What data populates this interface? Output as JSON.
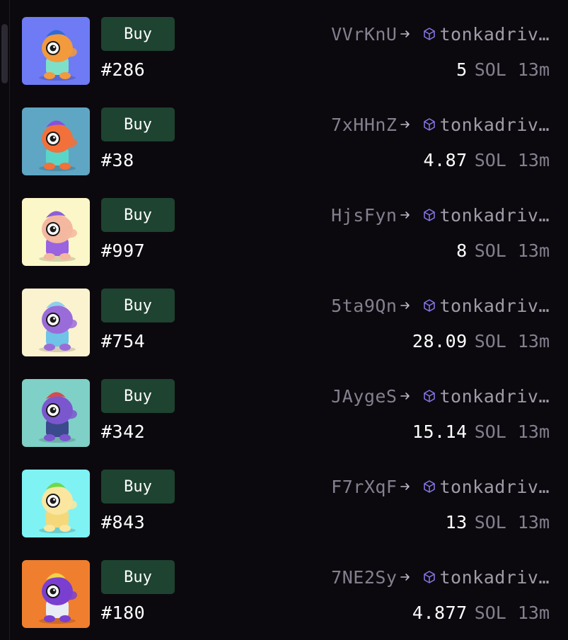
{
  "sales": [
    {
      "buy_label": "Buy",
      "token": "#286",
      "from": "VVrKnU",
      "to": "tonkadriv…",
      "price": "5",
      "unit": "SOL",
      "time": "13m",
      "bg": "#6e7bf5",
      "body": "#f29a3c",
      "accent": "#2f6bd6",
      "shirt": "#7fe0c9"
    },
    {
      "buy_label": "Buy",
      "token": "#38",
      "from": "7xHHnZ",
      "to": "tonkadriv…",
      "price": "4.87",
      "unit": "SOL",
      "time": "13m",
      "bg": "#5fa6c4",
      "body": "#f2703a",
      "accent": "#8a4fe0",
      "shirt": "#5ad6c8"
    },
    {
      "buy_label": "Buy",
      "token": "#997",
      "from": "HjsFyn",
      "to": "tonkadriv…",
      "price": "8",
      "unit": "SOL",
      "time": "13m",
      "bg": "#fbf7c8",
      "body": "#f4b8a0",
      "accent": "#8c5fd6",
      "shirt": "#9a63e0"
    },
    {
      "buy_label": "Buy",
      "token": "#754",
      "from": "5ta9Qn",
      "to": "tonkadriv…",
      "price": "28.09",
      "unit": "SOL",
      "time": "13m",
      "bg": "#fbf3cf",
      "body": "#9a6cd9",
      "accent": "#8fd0ec",
      "shirt": "#6fc3e6"
    },
    {
      "buy_label": "Buy",
      "token": "#342",
      "from": "JAygeS",
      "to": "tonkadriv…",
      "price": "15.14",
      "unit": "SOL",
      "time": "13m",
      "bg": "#7fd0c6",
      "body": "#7b57cf",
      "accent": "#d84b4b",
      "shirt": "#3a4a8c"
    },
    {
      "buy_label": "Buy",
      "token": "#843",
      "from": "F7rXqF",
      "to": "tonkadriv…",
      "price": "13",
      "unit": "SOL",
      "time": "13m",
      "bg": "#7ff3f3",
      "body": "#fbe6a0",
      "accent": "#6fd84a",
      "shirt": "#f5d87a"
    },
    {
      "buy_label": "Buy",
      "token": "#180",
      "from": "7NE2Sy",
      "to": "tonkadriv…",
      "price": "4.877",
      "unit": "SOL",
      "time": "13m",
      "bg": "#ef7f2e",
      "body": "#7a3fd0",
      "accent": "#f2d24a",
      "shirt": "#e8ecf5"
    }
  ],
  "icons": {
    "arrow": "arrow-right-icon",
    "wallet": "cube-icon"
  },
  "colors": {
    "background": "#0b090e",
    "buy_button": "#1e4331",
    "muted_text": "#84808f",
    "cube_icon": "#8878e8"
  }
}
